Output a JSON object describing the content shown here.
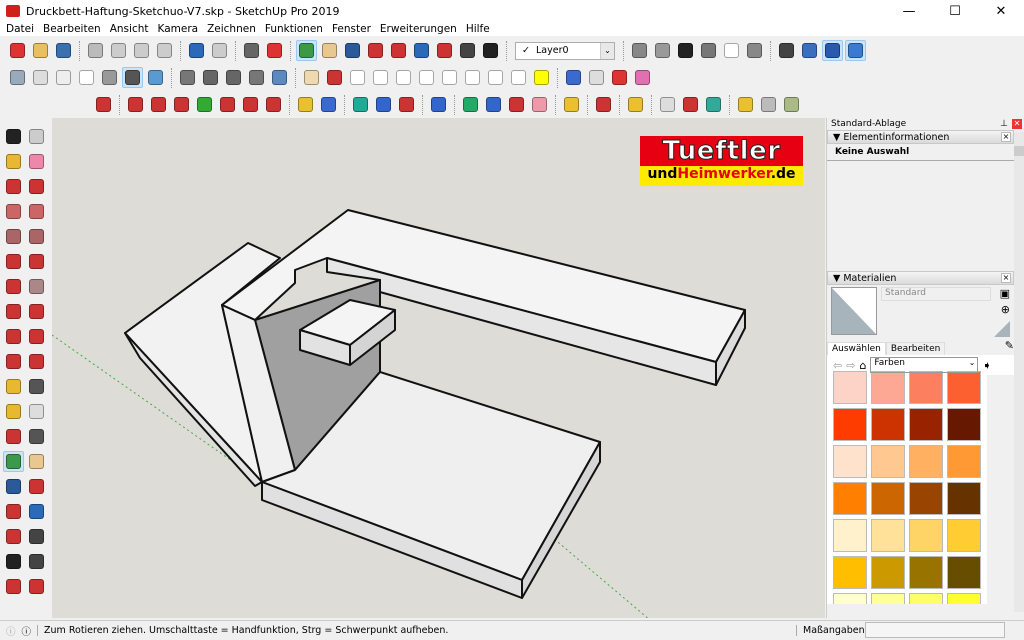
{
  "window": {
    "title": "Druckbett-Haftung-Sketchuo-V7.skp - SketchUp Pro 2019",
    "minimize": "—",
    "maximize": "☐",
    "close": "✕"
  },
  "menu": [
    "Datei",
    "Bearbeiten",
    "Ansicht",
    "Kamera",
    "Zeichnen",
    "Funktionen",
    "Fenster",
    "Erweiterungen",
    "Hilfe"
  ],
  "layer": {
    "check": "✓",
    "value": "Layer0"
  },
  "toolbar_row1_left": [
    {
      "name": "new-file-icon",
      "color": "#d33"
    },
    {
      "name": "open-icon",
      "color": "#e8c060"
    },
    {
      "name": "save-icon",
      "color": "#3a6fb0"
    },
    "sep",
    {
      "name": "cut-icon",
      "color": "#bbb"
    },
    {
      "name": "copy-icon",
      "color": "#ccc"
    },
    {
      "name": "paste-icon",
      "color": "#ccc"
    },
    {
      "name": "erase-icon",
      "color": "#ccc"
    },
    "sep",
    {
      "name": "undo-icon",
      "color": "#2a6ab8"
    },
    {
      "name": "redo-icon",
      "color": "#ccc"
    },
    "sep",
    {
      "name": "print-icon",
      "color": "#666"
    },
    {
      "name": "model-info-icon",
      "color": "#d33"
    },
    "sep",
    {
      "name": "orbit-icon",
      "color": "#3a9a4a",
      "active": true
    },
    {
      "name": "pan-icon",
      "color": "#e8c890"
    },
    {
      "name": "zoom-icon",
      "color": "#2a5a9a"
    },
    {
      "name": "zoom-window-icon",
      "color": "#c33"
    },
    {
      "name": "zoom-extents-icon",
      "color": "#c33"
    },
    {
      "name": "previous-view-icon",
      "color": "#2a6ab8"
    },
    {
      "name": "position-camera-icon",
      "color": "#c33"
    },
    {
      "name": "look-around-icon",
      "color": "#444"
    },
    {
      "name": "walk-icon",
      "color": "#222"
    },
    "sep"
  ],
  "toolbar_row1_right": [
    {
      "name": "iso-view-icon",
      "color": "#888"
    },
    {
      "name": "front-view-icon",
      "color": "#999"
    },
    {
      "name": "right-view-icon",
      "color": "#222"
    },
    {
      "name": "back-view-icon",
      "color": "#777"
    },
    {
      "name": "left-view-icon",
      "color": "#fff"
    },
    {
      "name": "top-view-icon",
      "color": "#888"
    },
    "sep",
    {
      "name": "section-plane-icon",
      "color": "#444"
    },
    {
      "name": "display-section-planes-icon",
      "color": "#3a6fc0"
    },
    {
      "name": "display-section-cuts-icon",
      "color": "#2a5ab0",
      "active": true
    },
    {
      "name": "section-fill-icon",
      "color": "#3a7ad0",
      "active": true
    }
  ],
  "toolbar_row2": [
    {
      "name": "xray-icon",
      "color": "#9ab"
    },
    {
      "name": "back-edges-icon",
      "color": "#ddd"
    },
    {
      "name": "wireframe-icon",
      "color": "#eee"
    },
    {
      "name": "hidden-line-icon",
      "color": "#fff"
    },
    {
      "name": "shaded-icon",
      "color": "#999"
    },
    {
      "name": "shaded-textures-icon",
      "color": "#555",
      "active": true
    },
    {
      "name": "monochrome-icon",
      "color": "#5a9ad0"
    },
    "sep",
    {
      "name": "components-icon",
      "color": "#777"
    },
    {
      "name": "groups-icon",
      "color": "#666"
    },
    {
      "name": "components-2-icon",
      "color": "#666"
    },
    {
      "name": "outliner-icon",
      "color": "#777"
    },
    {
      "name": "solid-tools-icon",
      "color": "#5a8ac0"
    },
    "sep",
    {
      "name": "eraser-icon",
      "color": "#eed9b0"
    },
    {
      "name": "pencil-icon",
      "color": "#c33"
    },
    {
      "name": "rectangle-icon",
      "color": "#fff"
    },
    {
      "name": "circle-icon",
      "color": "#fff"
    },
    {
      "name": "polygon-icon",
      "color": "#fff"
    },
    {
      "name": "arc-icon",
      "color": "#fff"
    },
    {
      "name": "ellipse-icon",
      "color": "#fff"
    },
    {
      "name": "parallelogram-icon",
      "color": "#fff"
    },
    {
      "name": "freehand-icon",
      "color": "#fff"
    },
    {
      "name": "shape-icon",
      "color": "#fff"
    },
    {
      "name": "curve-icon",
      "color": "#ff0"
    },
    "sep",
    {
      "name": "follow-me-icon",
      "color": "#3a6ad0"
    },
    {
      "name": "offset-icon",
      "color": "#ddd"
    },
    {
      "name": "scale-icon",
      "color": "#d33"
    },
    {
      "name": "paint-icon",
      "color": "#e070b0"
    }
  ],
  "toolbar_row3": [
    {
      "name": "move-red-icon",
      "color": "#c33"
    },
    "sep",
    {
      "name": "axis-e-icon",
      "color": "#c33"
    },
    {
      "name": "axis-j-icon",
      "color": "#c33"
    },
    {
      "name": "axis-r-icon",
      "color": "#c33"
    },
    {
      "name": "axis-y-icon",
      "color": "#3a3"
    },
    {
      "name": "axis-n-icon",
      "color": "#c33"
    },
    {
      "name": "axis-x-icon",
      "color": "#c33"
    },
    {
      "name": "axis-f-icon",
      "color": "#c33"
    },
    "sep",
    {
      "name": "uv-icon",
      "color": "#e8c030"
    },
    {
      "name": "projection-icon",
      "color": "#3a6ad0"
    },
    "sep",
    {
      "name": "extrude-icon",
      "color": "#2a9"
    },
    {
      "name": "up-arrow-icon",
      "color": "#36c"
    },
    {
      "name": "down-arrow-icon",
      "color": "#c33"
    },
    "sep",
    {
      "name": "diagonal-icon",
      "color": "#36c"
    },
    "sep",
    {
      "name": "mirror-icon",
      "color": "#2a6"
    },
    {
      "name": "rotate-icon",
      "color": "#36c"
    },
    {
      "name": "flip-icon",
      "color": "#c33"
    },
    {
      "name": "pink-icon",
      "color": "#e9a"
    },
    "sep",
    {
      "name": "triangle-icon",
      "color": "#e8c030"
    },
    "sep",
    {
      "name": "sphere-icon",
      "color": "#c33"
    },
    "sep",
    {
      "name": "texture-icon",
      "color": "#e8c030"
    },
    "sep",
    {
      "name": "soft-icon",
      "color": "#ddd"
    },
    {
      "name": "shape-set-icon",
      "color": "#c33"
    },
    {
      "name": "gem-icon",
      "color": "#3a9"
    },
    "sep",
    {
      "name": "box-yellow-icon",
      "color": "#e8c030"
    },
    {
      "name": "box-gray-icon",
      "color": "#bbb"
    },
    {
      "name": "box-olive-icon",
      "color": "#ab8"
    }
  ],
  "left_tools": [
    {
      "name": "select-icon",
      "color": "#222"
    },
    {
      "name": "make-component-icon",
      "color": "#ccc"
    },
    {
      "name": "paint-bucket-icon",
      "color": "#e8b830"
    },
    {
      "name": "eraser-icon",
      "color": "#e8a"
    },
    {
      "name": "line-icon",
      "color": "#c33"
    },
    {
      "name": "freehand-icon",
      "color": "#c33"
    },
    {
      "name": "rectangle-icon",
      "color": "#c66"
    },
    {
      "name": "rotated-rectangle-icon",
      "color": "#c66"
    },
    {
      "name": "circle-icon",
      "color": "#a66"
    },
    {
      "name": "polygon-icon",
      "color": "#a66"
    },
    {
      "name": "arc-icon",
      "color": "#c33"
    },
    {
      "name": "two-point-arc-icon",
      "color": "#c33"
    },
    {
      "name": "three-point-arc-icon",
      "color": "#c33"
    },
    {
      "name": "pie-icon",
      "color": "#a88"
    },
    {
      "name": "move-icon",
      "color": "#c33"
    },
    {
      "name": "push-pull-icon",
      "color": "#c33"
    },
    {
      "name": "rotate-icon",
      "color": "#c33"
    },
    {
      "name": "follow-me-icon",
      "color": "#c33"
    },
    {
      "name": "scale-icon",
      "color": "#c33"
    },
    {
      "name": "offset-icon",
      "color": "#c33"
    },
    {
      "name": "tape-measure-icon",
      "color": "#e8b830"
    },
    {
      "name": "dimension-icon",
      "color": "#555"
    },
    {
      "name": "protractor-icon",
      "color": "#e8b830"
    },
    {
      "name": "text-icon",
      "color": "#ddd"
    },
    {
      "name": "axes-icon",
      "color": "#c33"
    },
    {
      "name": "3d-text-icon",
      "color": "#555"
    },
    {
      "name": "orbit-icon",
      "color": "#3a9a4a",
      "active": true
    },
    {
      "name": "pan-icon",
      "color": "#e8c890"
    },
    {
      "name": "zoom-icon",
      "color": "#2a5a9a"
    },
    {
      "name": "zoom-window-icon",
      "color": "#c33"
    },
    {
      "name": "zoom-extents-icon",
      "color": "#c33"
    },
    {
      "name": "previous-icon",
      "color": "#2a6ab8"
    },
    {
      "name": "position-camera-icon",
      "color": "#c33"
    },
    {
      "name": "look-around-icon",
      "color": "#444"
    },
    {
      "name": "walk-icon",
      "color": "#222"
    },
    {
      "name": "section-plane-icon",
      "color": "#444"
    },
    {
      "name": "warehouse-icon",
      "color": "#c33"
    },
    {
      "name": "extension-icon",
      "color": "#c33"
    }
  ],
  "logo": {
    "line1": "Tueftler",
    "line2a": "und",
    "line2b": "Heimwerker",
    "line2c": ".de"
  },
  "panel": {
    "title": "Standard-Ablage",
    "entity_info": {
      "title": "Elementinformationen",
      "value": "Keine Auswahl"
    },
    "materials": {
      "title": "Materialien",
      "name_field": "Standard",
      "tab_select": "Auswählen",
      "tab_edit": "Bearbeiten",
      "library": "Farben"
    },
    "swatches": [
      "#fdd3c8",
      "#fca895",
      "#fc8060",
      "#fd6030",
      "#ff3c00",
      "#cc3300",
      "#992200",
      "#661800",
      "#ffe2cc",
      "#ffc890",
      "#ffb060",
      "#ff9933",
      "#ff8000",
      "#cc6600",
      "#994400",
      "#663300",
      "#fff1cc",
      "#ffe199",
      "#ffd466",
      "#ffcc33",
      "#ffbf00",
      "#cc9900",
      "#997300",
      "#664d00",
      "#ffffcc",
      "#ffff99",
      "#ffff66",
      "#ffff33"
    ]
  },
  "status": {
    "message": "Zum Rotieren ziehen. Umschalttaste = Handfunktion, Strg = Schwerpunkt aufheben.",
    "measure_label": "Maßangaben",
    "measure_value": ""
  }
}
